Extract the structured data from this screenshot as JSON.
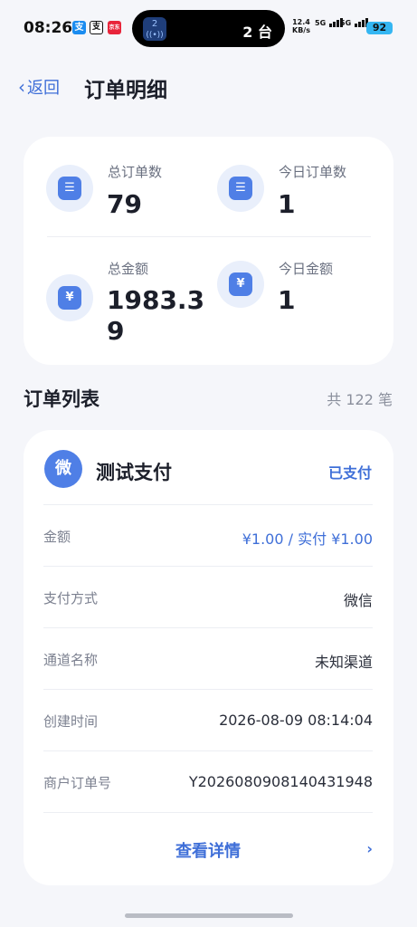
{
  "status_bar": {
    "time": "08:26",
    "app_icons": [
      "支",
      "支",
      "京东"
    ],
    "island_badge": "2",
    "island_text": "2 台",
    "net_speed_value": "12.4",
    "net_speed_unit": "KB/s",
    "signal_1": "5G",
    "signal_2": "5G",
    "battery": "92"
  },
  "header": {
    "back_label": "返回",
    "title": "订单明细"
  },
  "stats": {
    "total_orders_label": "总订单数",
    "total_orders_value": "79",
    "today_orders_label": "今日订单数",
    "today_orders_value": "1",
    "total_amount_label": "总金额",
    "total_amount_value": "1983.39",
    "today_amount_label": "今日金额",
    "today_amount_value": "1",
    "order_icon_glyph": "☰",
    "amount_icon_glyph": "¥"
  },
  "list": {
    "title": "订单列表",
    "count_text": "共 122 笔"
  },
  "order": {
    "avatar_text": "微",
    "name": "测试支付",
    "status": "已支付",
    "rows": [
      {
        "label": "金额",
        "value": "¥1.00 / 实付 ¥1.00"
      },
      {
        "label": "支付方式",
        "value": "微信"
      },
      {
        "label": "通道名称",
        "value": "未知渠道"
      },
      {
        "label": "创建时间",
        "value": "2026-08-09 08:14:04"
      },
      {
        "label": "商户订单号",
        "value": "Y2026080908140431948"
      }
    ],
    "detail_label": "查看详情",
    "detail_chevron": "›"
  },
  "colors": {
    "accent": "#3f6fd8",
    "icon_bg": "#4f7fe6",
    "page_bg": "#f5f6fa"
  }
}
